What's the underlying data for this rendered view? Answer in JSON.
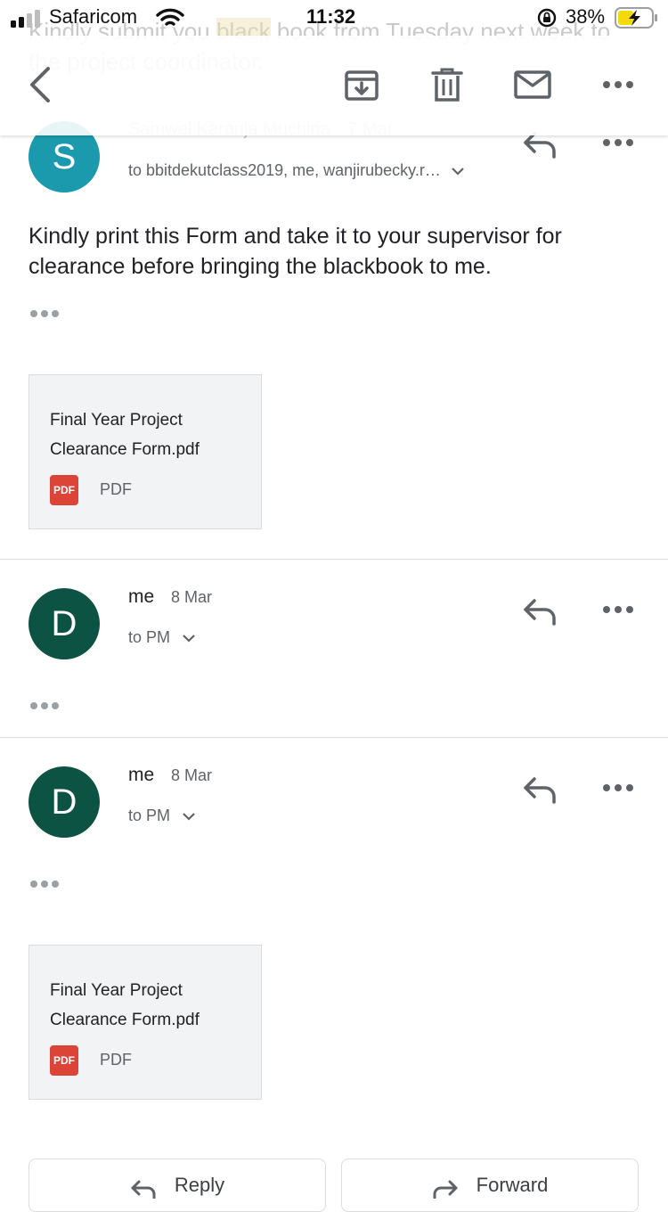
{
  "status_bar": {
    "carrier": "Safaricom",
    "time": "11:32",
    "battery": "38%"
  },
  "background_thread": {
    "text_before": "Kindly submit you ",
    "highlight": "black",
    "text_after": " book from Tuesday next week to the project coordinator."
  },
  "app_bar": {
    "icons": [
      "back-arrow-icon",
      "archive-icon",
      "delete-icon",
      "mail-icon",
      "more-icon"
    ]
  },
  "messages": [
    {
      "avatar_letter": "S",
      "avatar_color": "#1a9aac",
      "sender": "Samwel Karanja Muchina",
      "date": "7 Mar",
      "recipients": "to bbitdekutclass2019, me, wanjirubecky.r…",
      "body": "Kindly print this Form and take it to your supervisor for clearance before bringing the blackbook to me.",
      "attachment": {
        "name": "Final Year Project Clearance Form.pdf",
        "badge": "PDF",
        "type": "PDF"
      }
    },
    {
      "avatar_letter": "D",
      "avatar_color": "#0d5343",
      "sender": "me",
      "date": "8 Mar",
      "recipients": "to PM"
    },
    {
      "avatar_letter": "D",
      "avatar_color": "#0d5343",
      "sender": "me",
      "date": "8 Mar",
      "recipients": "to PM",
      "attachment": {
        "name": "Final Year Project Clearance Form.pdf",
        "badge": "PDF",
        "type": "PDF"
      }
    }
  ],
  "bottom_actions": {
    "reply": "Reply",
    "forward": "Forward"
  },
  "colors": {
    "accent_red": "#db4437",
    "icon_gray": "#5f6368"
  }
}
